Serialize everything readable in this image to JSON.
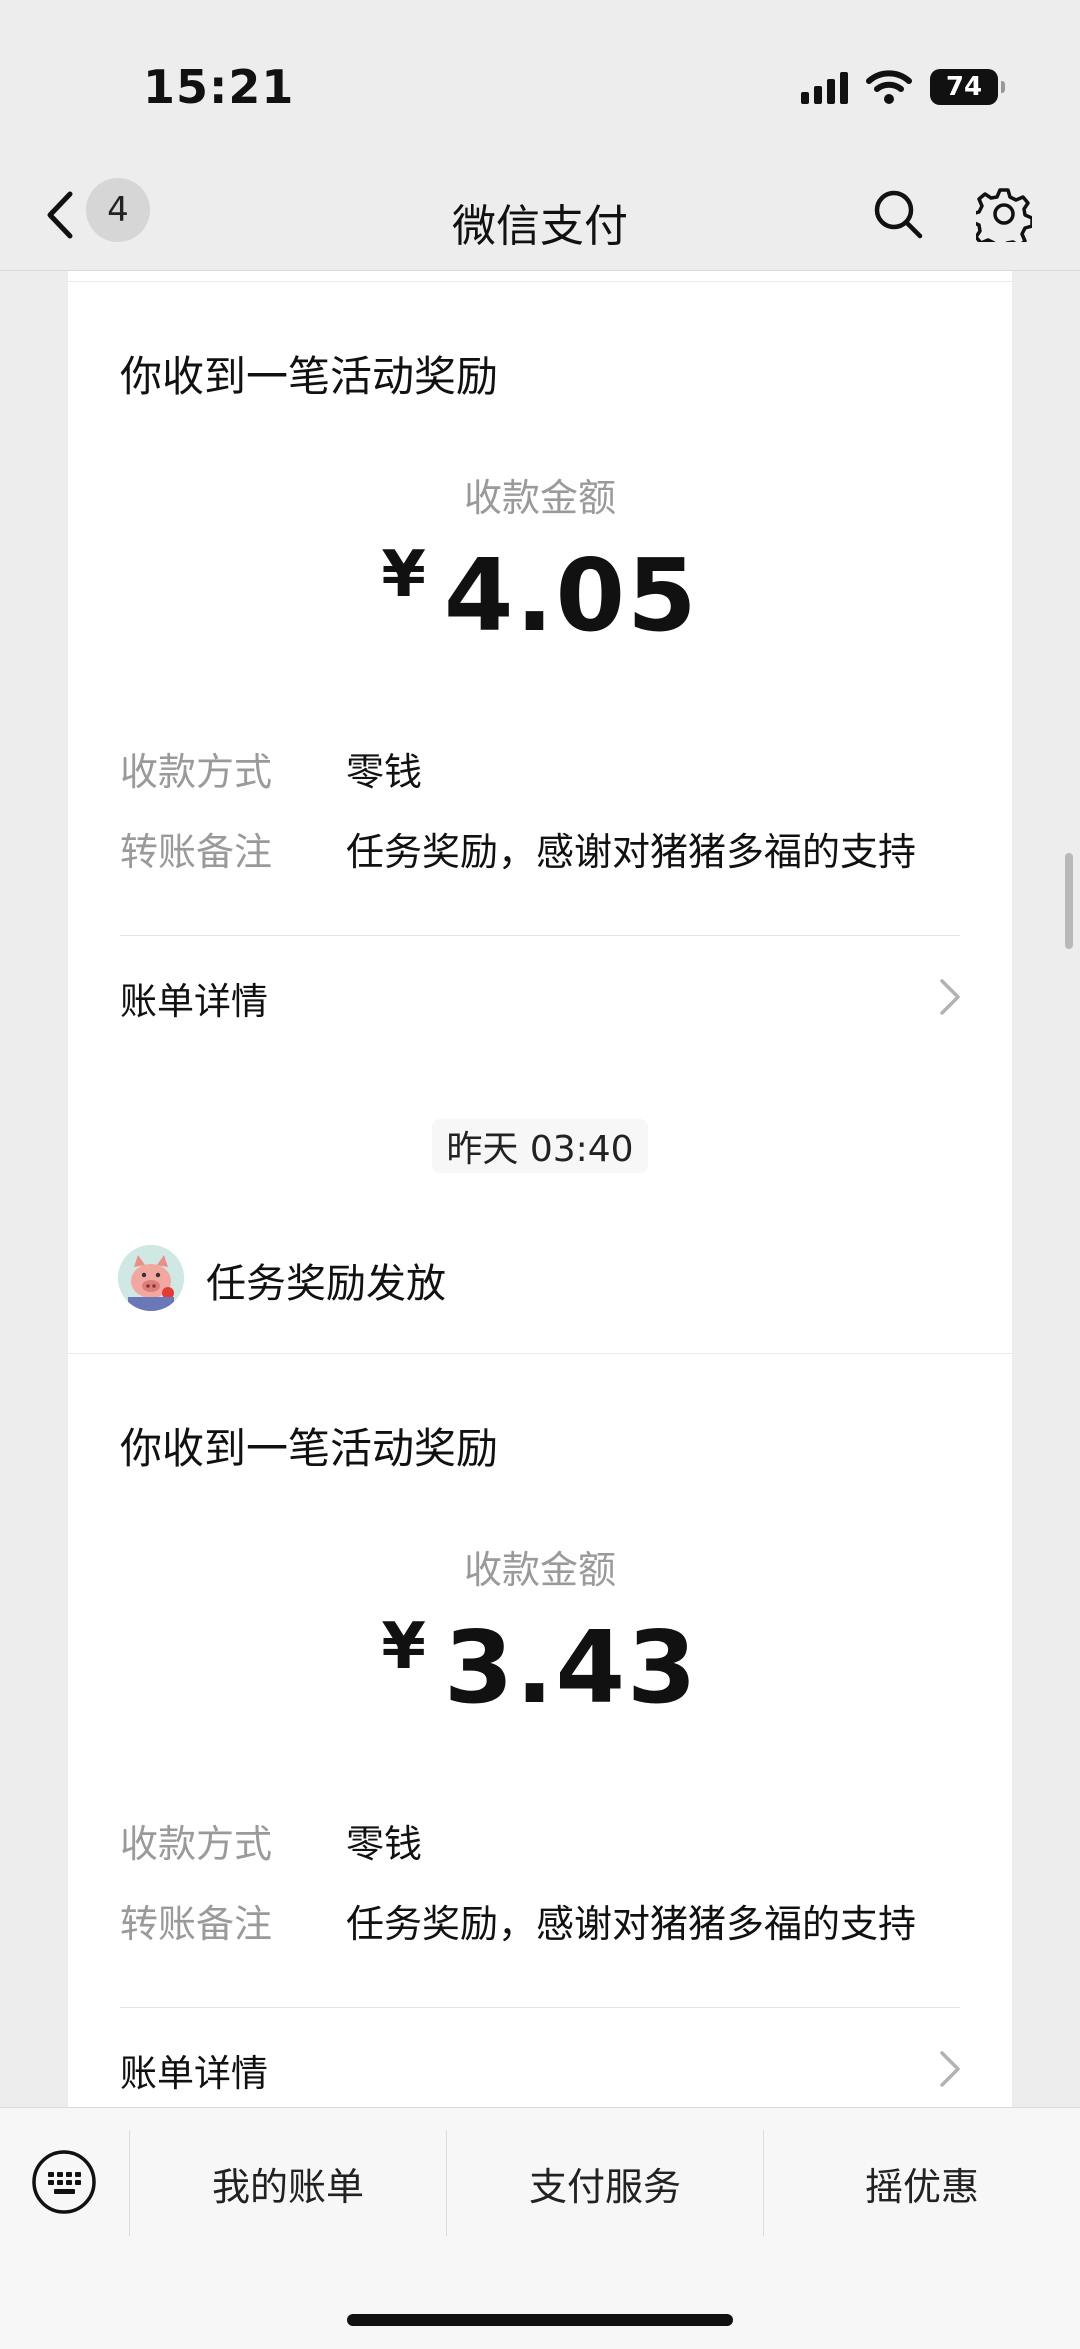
{
  "status_bar": {
    "time": "15:21",
    "battery": "74"
  },
  "nav": {
    "back_count": "4",
    "title": "微信支付"
  },
  "card1": {
    "heading": "你收到一笔活动奖励",
    "amount_label": "收款金额",
    "currency": "¥",
    "amount": "4.05",
    "method_label": "收款方式",
    "method_value": "零钱",
    "note_label": "转账备注",
    "note_value": "任务奖励，感谢对猪猪多福的支持",
    "detail_label": "账单详情"
  },
  "timestamp": "昨天 03:40",
  "card2": {
    "sender": "任务奖励发放",
    "heading": "你收到一笔活动奖励",
    "amount_label": "收款金额",
    "currency": "¥",
    "amount": "3.43",
    "method_label": "收款方式",
    "method_value": "零钱",
    "note_label": "转账备注",
    "note_value": "任务奖励，感谢对猪猪多福的支持",
    "detail_label": "账单详情"
  },
  "bottom_menu": {
    "items": [
      {
        "label": "我的账单"
      },
      {
        "label": "支付服务"
      },
      {
        "label": "摇优惠"
      }
    ]
  },
  "icons": [
    "back-icon",
    "search-icon",
    "gear-icon",
    "chevron-right-icon",
    "keyboard-icon",
    "wifi-icon",
    "signal-icon",
    "battery-icon"
  ]
}
